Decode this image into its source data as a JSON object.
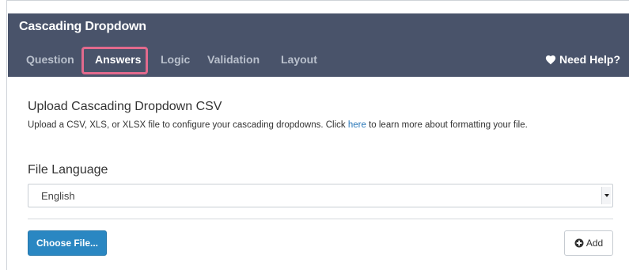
{
  "header": {
    "title": "Cascading Dropdown",
    "help_label": "Need Help?",
    "tabs": [
      {
        "label": "Question",
        "active": false
      },
      {
        "label": "Answers",
        "active": true
      },
      {
        "label": "Logic",
        "active": false
      },
      {
        "label": "Validation",
        "active": false
      },
      {
        "label": "Layout",
        "active": false
      }
    ]
  },
  "upload": {
    "title": "Upload Cascading Dropdown CSV",
    "desc_before": "Upload a CSV, XLS, or XLSX file to configure your cascading dropdowns. Click ",
    "desc_link": "here",
    "desc_after": " to learn more about formatting your file."
  },
  "language": {
    "label": "File Language",
    "selected": "English"
  },
  "actions": {
    "choose_label": "Choose File...",
    "add_label": "Add"
  },
  "colors": {
    "header_bg": "#49536a",
    "highlight": "#e26a8d",
    "primary": "#2a87c2",
    "link": "#2a77b8"
  },
  "icons": {
    "help": "heart-icon",
    "add": "plus-circle-icon",
    "select": "caret-down-icon"
  }
}
